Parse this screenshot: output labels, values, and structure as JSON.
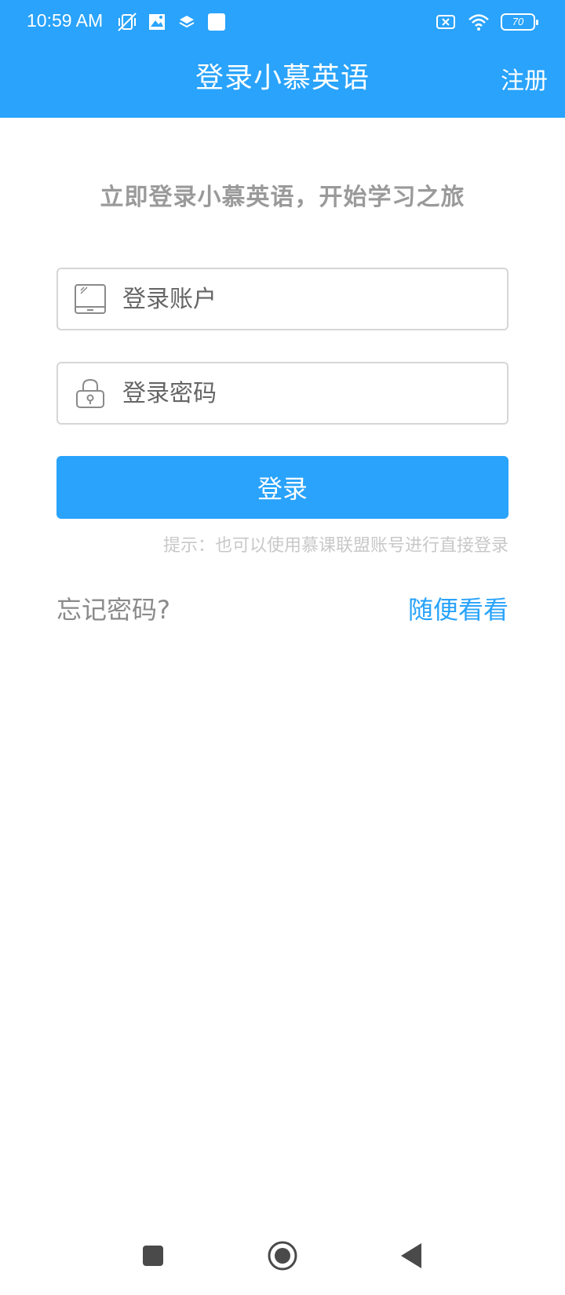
{
  "status_bar": {
    "time": "10:59 AM",
    "battery": "70",
    "icons_left": [
      "vibrate-off-icon",
      "gallery-icon",
      "layers-icon",
      "square-icon"
    ],
    "icons_right": [
      "sim-x-icon",
      "wifi-icon",
      "battery-icon"
    ]
  },
  "header": {
    "title": "登录小慕英语",
    "register_label": "注册"
  },
  "main": {
    "tagline": "立即登录小慕英语，开始学习之旅",
    "account_placeholder": "登录账户",
    "account_value": "",
    "password_placeholder": "登录密码",
    "password_value": "",
    "login_label": "登录",
    "hint": "提示：也可以使用慕课联盟账号进行直接登录",
    "forgot_label": "忘记密码?",
    "browse_label": "随便看看"
  },
  "nav_bar": {
    "buttons": [
      "recents-icon",
      "home-icon",
      "back-icon"
    ]
  },
  "colors": {
    "primary": "#29a3fb",
    "tagline": "#9a9a9a",
    "hint": "#c8c8c8",
    "border": "#d6d6d6"
  }
}
